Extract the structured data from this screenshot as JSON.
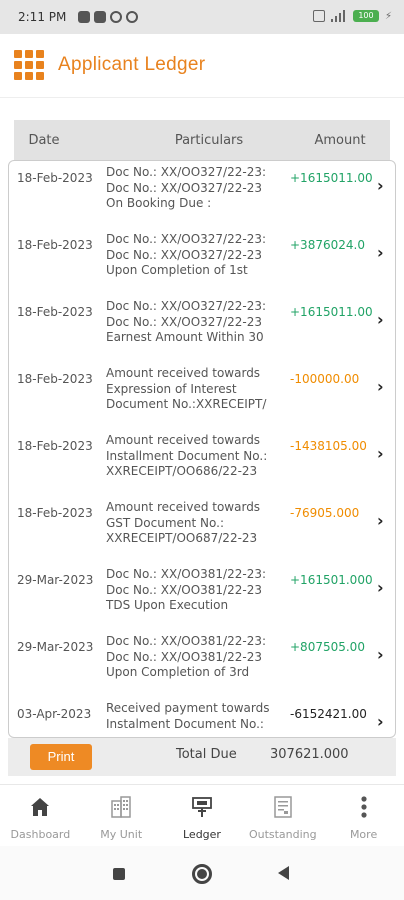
{
  "status_bar": {
    "time": "2:11 PM",
    "battery": "100"
  },
  "header": {
    "title": "Applicant Ledger"
  },
  "table": {
    "columns": [
      "Date",
      "Particulars",
      "Amount"
    ],
    "rows": [
      {
        "date": "18-Feb-2023",
        "particulars": [
          "Doc No.: XX/OO327/22-23:",
          "Doc No.: XX/OO327/22-23",
          "On Booking Due :"
        ],
        "amount": "+1615011.00",
        "tone": "green"
      },
      {
        "date": "18-Feb-2023",
        "particulars": [
          "Doc No.: XX/OO327/22-23:",
          "Doc No.: XX/OO327/22-23",
          "Upon Completion of 1st"
        ],
        "amount": "+3876024.0",
        "tone": "green"
      },
      {
        "date": "18-Feb-2023",
        "particulars": [
          "Doc No.: XX/OO327/22-23:",
          "Doc No.: XX/OO327/22-23",
          "Earnest Amount Within 30"
        ],
        "amount": "+1615011.00",
        "tone": "green"
      },
      {
        "date": "18-Feb-2023",
        "particulars": [
          "Amount received towards",
          "Expression of Interest",
          "Document No.:XXRECEIPT/"
        ],
        "amount": "-100000.00",
        "tone": "orange"
      },
      {
        "date": "18-Feb-2023",
        "particulars": [
          "Amount received towards",
          "Installment Document No.:",
          "XXRECEIPT/OO686/22-23"
        ],
        "amount": "-1438105.00",
        "tone": "orange"
      },
      {
        "date": "18-Feb-2023",
        "particulars": [
          "Amount received towards",
          "GST Document No.:",
          "XXRECEIPT/OO687/22-23"
        ],
        "amount": "-76905.000",
        "tone": "orange"
      },
      {
        "date": "29-Mar-2023",
        "particulars": [
          "Doc No.: XX/OO381/22-23:",
          "Doc No.: XX/OO381/22-23",
          "TDS Upon Execution"
        ],
        "amount": "+161501.000",
        "tone": "green"
      },
      {
        "date": "29-Mar-2023",
        "particulars": [
          "Doc No.: XX/OO381/22-23:",
          "Doc No.: XX/OO381/22-23",
          "Upon Completion of 3rd"
        ],
        "amount": "+807505.00",
        "tone": "green"
      },
      {
        "date": "03-Apr-2023",
        "particulars": [
          "Received payment towards",
          "Instalment  Document No.:"
        ],
        "amount": "-6152421.00",
        "tone": "black"
      }
    ]
  },
  "summary": {
    "print_label": "Print",
    "total_label": "Total Due",
    "total_value": "307621.000"
  },
  "bottom_nav": [
    {
      "label": "Dashboard",
      "icon": "home-icon"
    },
    {
      "label": "My Unit",
      "icon": "building-icon"
    },
    {
      "label": "Ledger",
      "icon": "ledger-icon"
    },
    {
      "label": "Outstanding",
      "icon": "document-icon"
    },
    {
      "label": "More",
      "icon": "more-vertical-icon"
    }
  ],
  "colors": {
    "accent": "#e8821e",
    "positive": "#21a366",
    "negative": "#f08c00"
  }
}
